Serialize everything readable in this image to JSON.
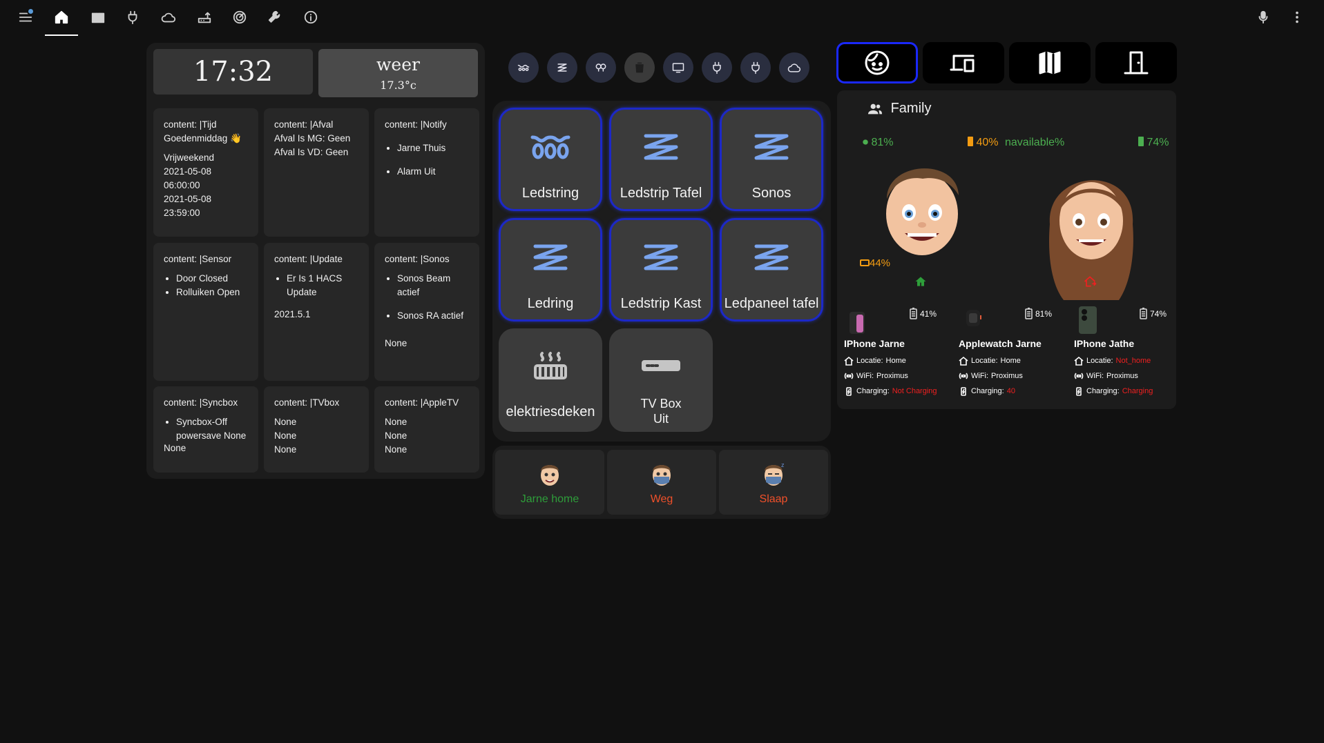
{
  "toolbar": {
    "icons": [
      "menu-icon",
      "home-icon",
      "movie-icon",
      "plug-icon",
      "cloud-icon",
      "router-icon",
      "radar-icon",
      "wrench-icon",
      "info-icon",
      "microphone-icon",
      "more-icon"
    ]
  },
  "clock": {
    "time": "17:32"
  },
  "weather": {
    "title": "weer",
    "temp": "17.3°c"
  },
  "content_cards": [
    {
      "lines": [
        "content: |Tijd",
        "Goedenmiddag 👋"
      ],
      "extra": [
        "Vrijweekend",
        "2021-05-08",
        "06:00:00",
        "2021-05-08",
        "23:59:00"
      ]
    },
    {
      "lines": [
        "content: |Afval",
        "Afval Is MG: Geen",
        "Afval Is VD: Geen"
      ]
    },
    {
      "title": "content: |Notify",
      "bullets": [
        "Jarne Thuis",
        "Alarm Uit"
      ]
    },
    {
      "title": "content: |Sensor",
      "bullets": [
        "Door Closed",
        "Rolluiken Open"
      ]
    },
    {
      "title": "content: |Update",
      "bullets": [
        "Er Is 1 HACS Update"
      ],
      "after": "2021.5.1"
    },
    {
      "title": "content: |Sonos",
      "bullets": [
        "Sonos Beam actief",
        "Sonos RA actief"
      ],
      "after": "None"
    },
    {
      "title": "content: |Syncbox",
      "bullets": [
        "Syncbox-Off powersave None"
      ],
      "after_inline": "None"
    },
    {
      "lines": [
        "content: |TVbox"
      ],
      "extra": [
        "None",
        "None",
        "None"
      ]
    },
    {
      "lines": [
        "content: |AppleTV"
      ],
      "extra": [
        "None",
        "None",
        "None"
      ]
    }
  ],
  "quick_icons": [
    "ledstring-icon",
    "ledstrip-icon",
    "lightbulb-group-icon",
    "trash-icon",
    "monitor-icon",
    "plug-icon",
    "plug-icon",
    "cloud-icon"
  ],
  "tiles": [
    {
      "label": "Ledstring",
      "icon": "ledstring-icon",
      "on": true
    },
    {
      "label": "Ledstrip Tafel",
      "icon": "ledstrip-icon",
      "on": true
    },
    {
      "label": "Sonos",
      "icon": "ledstrip-icon",
      "on": true
    },
    {
      "label": "Ledring",
      "icon": "ledstrip-icon",
      "on": true
    },
    {
      "label": "Ledstrip Kast",
      "icon": "ledstrip-icon",
      "on": true
    },
    {
      "label": "Ledpaneel tafel",
      "icon": "ledstrip-icon",
      "on": true
    },
    {
      "label": "elektriesdeken",
      "icon": "heated-blanket-icon",
      "on": false
    },
    {
      "label": "TV Box",
      "label2": "Uit",
      "icon": "set-top-box-icon",
      "on": false
    }
  ],
  "person_states": [
    {
      "label": "Jarne home",
      "color": "#2e9e3a"
    },
    {
      "label": "Weg",
      "color": "#f0502a"
    },
    {
      "label": "Slaap",
      "color": "#f0502a"
    }
  ],
  "nav_buttons": [
    "face-icon",
    "devices-icon",
    "map-icon",
    "door-icon"
  ],
  "family": {
    "title": "Family",
    "jarne": {
      "bat_left": "81%",
      "bat_mid": "40%",
      "bat_watch": "44%"
    },
    "jathe": {
      "bat_label": "navailable%",
      "bat_right": "74%"
    },
    "devices": [
      {
        "name": "IPhone Jarne",
        "battery": "41%",
        "locatie_label": "Locatie:",
        "locatie": "Home",
        "wifi_label": "WiFi:",
        "wifi": "Proximus",
        "charging_label": "Charging:",
        "charging": "Not Charging",
        "charging_color": "#f02020",
        "locatie_color": "#ffffff"
      },
      {
        "name": "Applewatch Jarne",
        "battery": "81%",
        "locatie_label": "Locatie:",
        "locatie": "Home",
        "wifi_label": "WiFi:",
        "wifi": "Proximus",
        "charging_label": "Charging:",
        "charging": "40",
        "charging_color": "#f02020",
        "locatie_color": "#ffffff"
      },
      {
        "name": "IPhone Jathe",
        "battery": "74%",
        "locatie_label": "Locatie:",
        "locatie": "Not_home",
        "wifi_label": "WiFi:",
        "wifi": "Proximus",
        "charging_label": "Charging:",
        "charging": "Charging",
        "charging_color": "#f02020",
        "locatie_color": "#f02020"
      }
    ]
  }
}
